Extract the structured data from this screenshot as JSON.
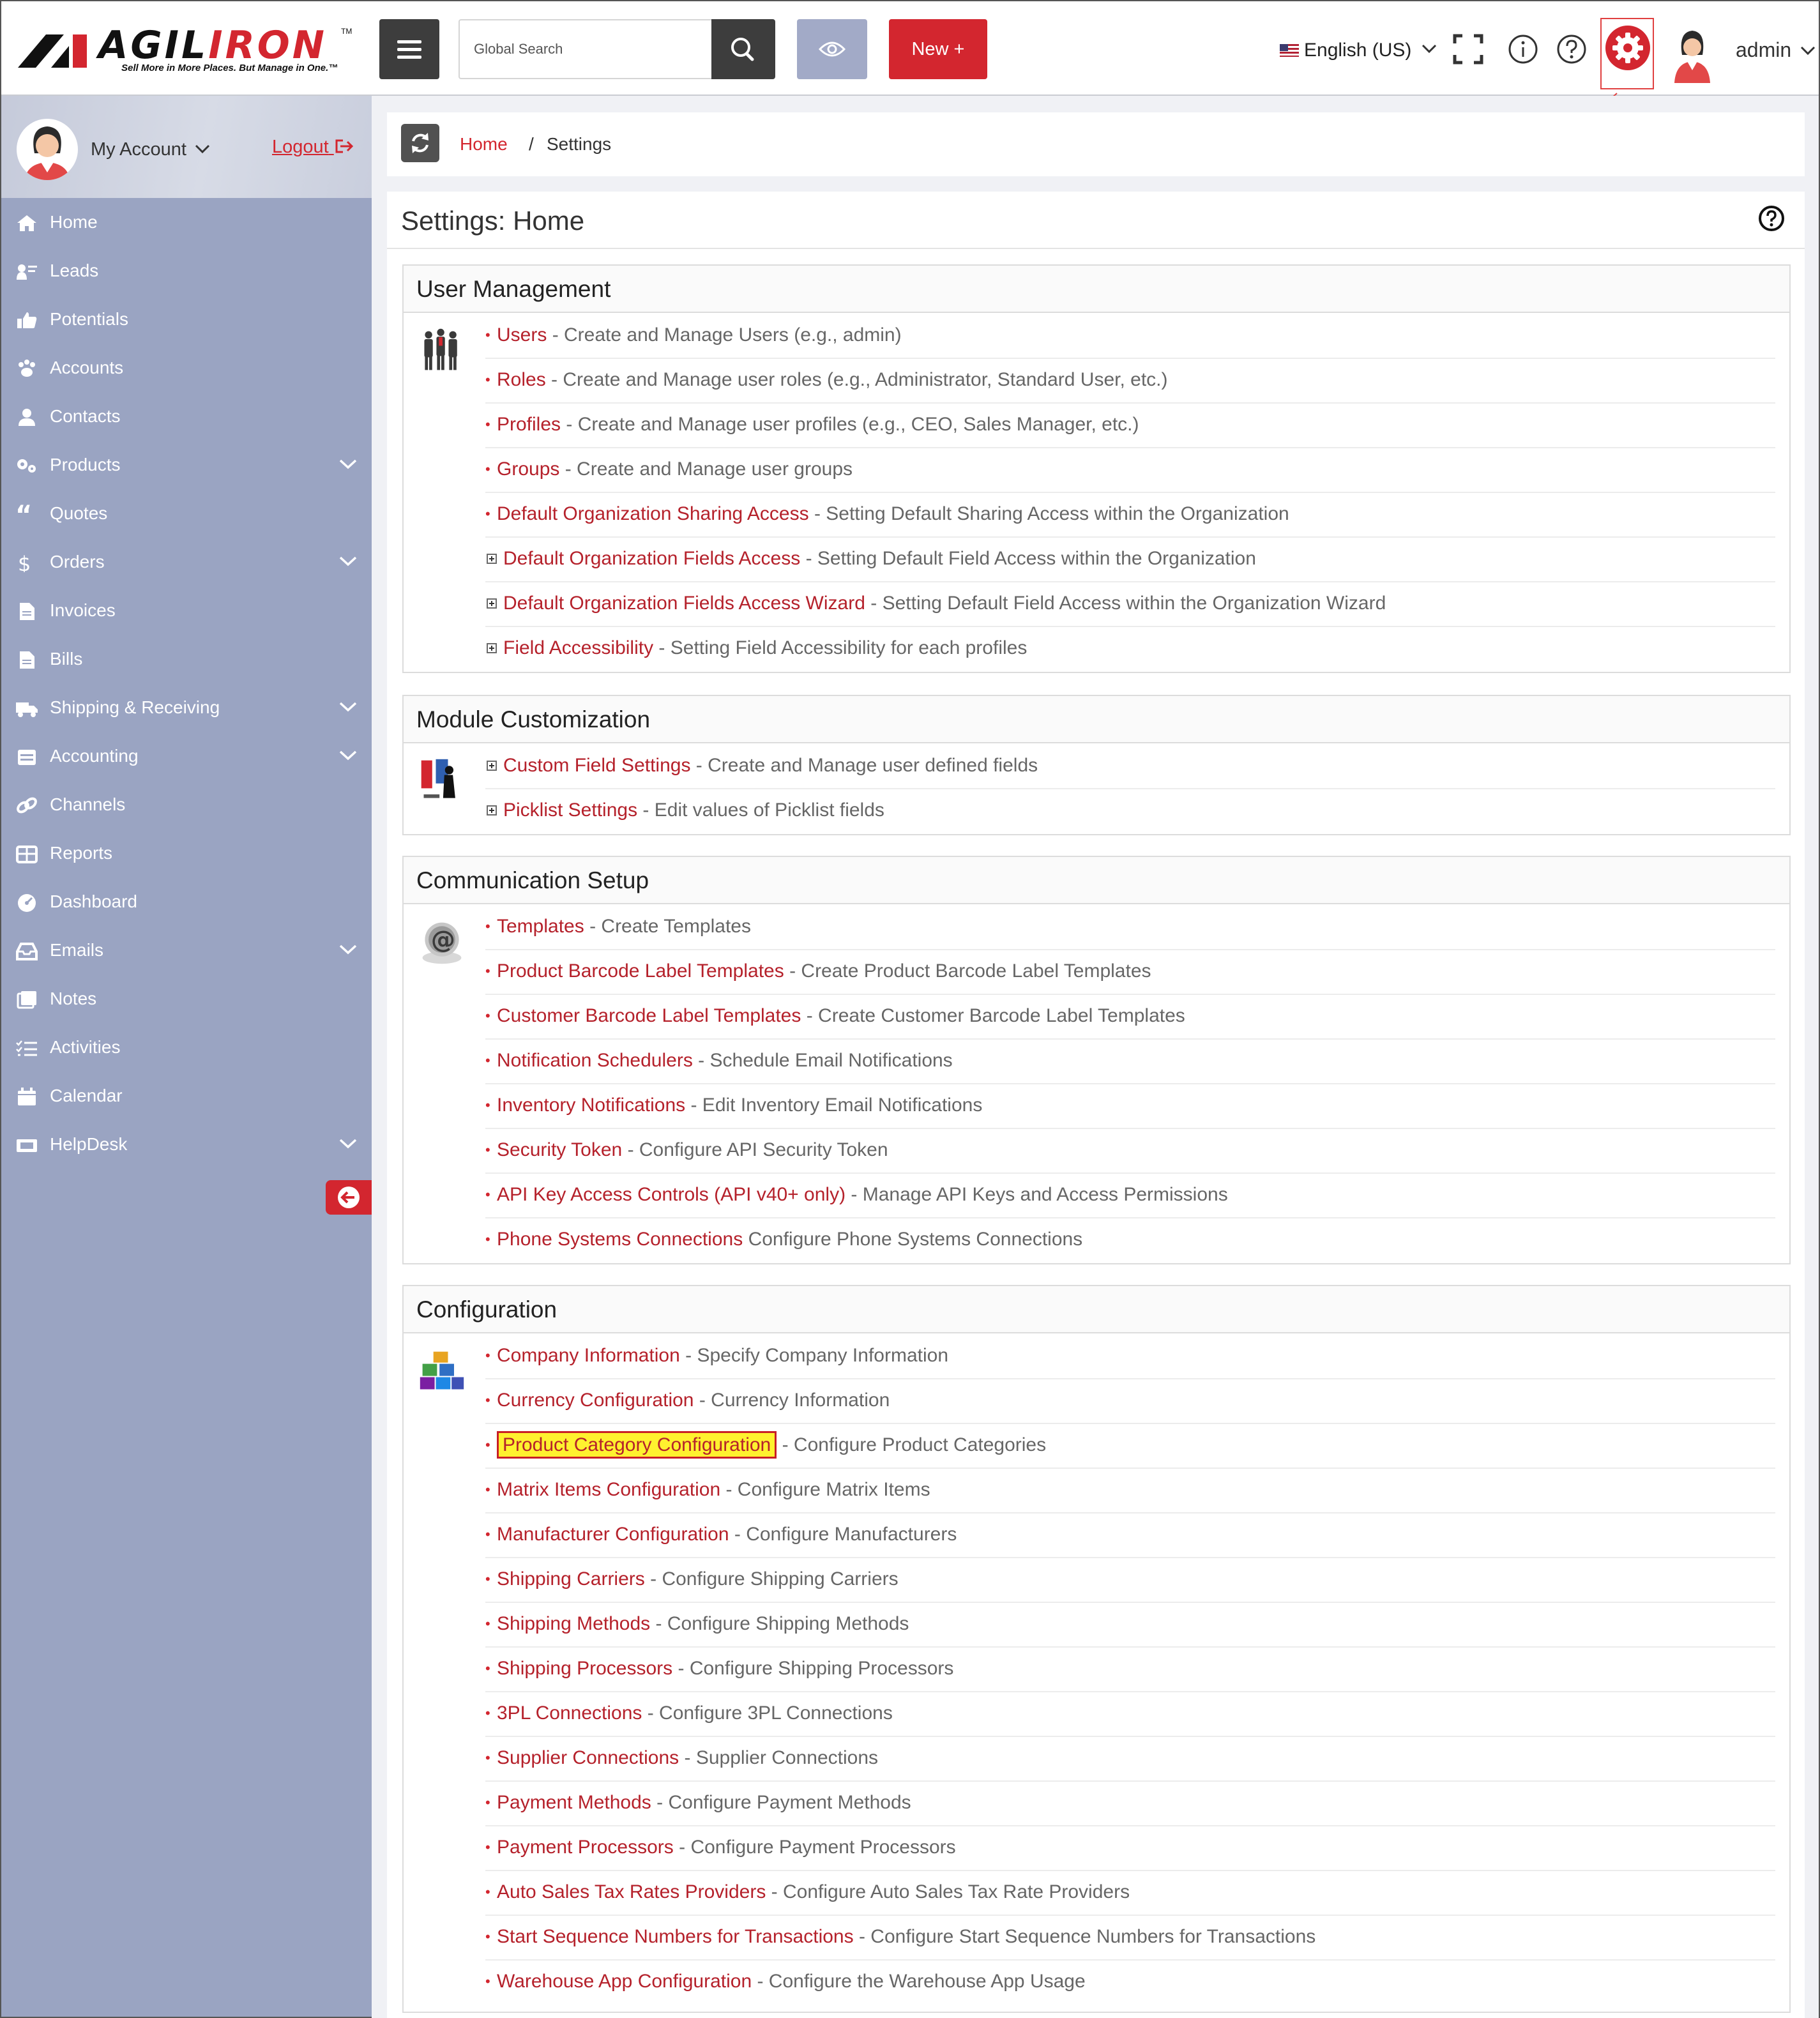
{
  "brand": {
    "name_dark": "AGIL",
    "name_red": "IRON",
    "tm": "TM",
    "tagline": "Sell More in More Places. But Manage in One.™"
  },
  "topbar": {
    "search_placeholder": "Global Search",
    "new_label": "New +",
    "language": "English (US)",
    "user": "admin",
    "icons": [
      "menu-icon",
      "search-icon",
      "eye-icon",
      "fullscreen-icon",
      "info-icon",
      "help-icon",
      "gear-icon",
      "avatar"
    ],
    "accent": "#d3262f"
  },
  "sidebar": {
    "account_label": "My Account",
    "logout_label": "Logout",
    "bg": "#9aa4c2",
    "items": [
      {
        "label": "Home",
        "icon": "home-icon",
        "expandable": false
      },
      {
        "label": "Leads",
        "icon": "leads-icon",
        "expandable": false
      },
      {
        "label": "Potentials",
        "icon": "thumbs-up-icon",
        "expandable": false
      },
      {
        "label": "Accounts",
        "icon": "paw-icon",
        "expandable": false
      },
      {
        "label": "Contacts",
        "icon": "user-icon",
        "expandable": false
      },
      {
        "label": "Products",
        "icon": "gears-icon",
        "expandable": true
      },
      {
        "label": "Quotes",
        "icon": "quote-icon",
        "expandable": false
      },
      {
        "label": "Orders",
        "icon": "dollar-icon",
        "expandable": true
      },
      {
        "label": "Invoices",
        "icon": "file-icon",
        "expandable": false
      },
      {
        "label": "Bills",
        "icon": "file-icon",
        "expandable": false
      },
      {
        "label": "Shipping & Receiving",
        "icon": "truck-icon",
        "expandable": true
      },
      {
        "label": "Accounting",
        "icon": "calculator-icon",
        "expandable": true
      },
      {
        "label": "Channels",
        "icon": "link-icon",
        "expandable": false
      },
      {
        "label": "Reports",
        "icon": "table-icon",
        "expandable": false
      },
      {
        "label": "Dashboard",
        "icon": "dashboard-icon",
        "expandable": false
      },
      {
        "label": "Emails",
        "icon": "inbox-icon",
        "expandable": true
      },
      {
        "label": "Notes",
        "icon": "notes-icon",
        "expandable": false
      },
      {
        "label": "Activities",
        "icon": "list-icon",
        "expandable": false
      },
      {
        "label": "Calendar",
        "icon": "calendar-icon",
        "expandable": false
      },
      {
        "label": "HelpDesk",
        "icon": "ticket-icon",
        "expandable": true
      }
    ]
  },
  "breadcrumb": {
    "home": "Home",
    "separator": "/",
    "current": "Settings"
  },
  "page": {
    "title": "Settings: Home"
  },
  "sections": [
    {
      "title": "User Management",
      "image": "users-group-icon",
      "items": [
        {
          "marker": "bullet",
          "link": "Users",
          "desc": "- Create and Manage Users (e.g., admin)"
        },
        {
          "marker": "bullet",
          "link": "Roles",
          "desc": "- Create and Manage user roles (e.g., Administrator, Standard User, etc.)"
        },
        {
          "marker": "bullet",
          "link": "Profiles",
          "desc": "- Create and Manage user profiles (e.g., CEO, Sales Manager, etc.)"
        },
        {
          "marker": "bullet",
          "link": "Groups",
          "desc": "- Create and Manage user groups"
        },
        {
          "marker": "bullet",
          "link": "Default Organization Sharing Access",
          "desc": "- Setting Default Sharing Access within the Organization"
        },
        {
          "marker": "plus",
          "link": "Default Organization Fields Access",
          "desc": "- Setting Default Field Access within the Organization"
        },
        {
          "marker": "plus",
          "link": "Default Organization Fields Access Wizard",
          "desc": "- Setting Default Field Access within the Organization Wizard"
        },
        {
          "marker": "plus",
          "link": "Field Accessibility",
          "desc": "- Setting Field Accessibility for each profiles"
        }
      ]
    },
    {
      "title": "Module Customization",
      "image": "custom-fields-icon",
      "items": [
        {
          "marker": "plus",
          "link": "Custom Field Settings",
          "desc": "- Create and Manage user defined fields"
        },
        {
          "marker": "plus",
          "link": "Picklist Settings",
          "desc": "- Edit values of Picklist fields"
        }
      ]
    },
    {
      "title": "Communication Setup",
      "image": "email-at-icon",
      "items": [
        {
          "marker": "bullet",
          "link": "Templates",
          "desc": "- Create Templates"
        },
        {
          "marker": "bullet",
          "link": "Product Barcode Label Templates",
          "desc": "- Create Product Barcode Label Templates"
        },
        {
          "marker": "bullet",
          "link": "Customer Barcode Label Templates",
          "desc": "- Create Customer Barcode Label Templates"
        },
        {
          "marker": "bullet",
          "link": "Notification Schedulers",
          "desc": "- Schedule Email Notifications"
        },
        {
          "marker": "bullet",
          "link": "Inventory Notifications",
          "desc": "- Edit Inventory Email Notifications"
        },
        {
          "marker": "bullet",
          "link": "Security Token",
          "desc": "- Configure API Security Token"
        },
        {
          "marker": "bullet",
          "link": "API Key Access Controls (API v40+ only)",
          "desc": "- Manage API Keys and Access Permissions"
        },
        {
          "marker": "bullet",
          "link": "Phone Systems Connections",
          "desc": "Configure Phone Systems Connections"
        }
      ]
    },
    {
      "title": "Configuration",
      "image": "config-blocks-icon",
      "items": [
        {
          "marker": "bullet",
          "link": "Company Information",
          "desc": "- Specify Company Information"
        },
        {
          "marker": "bullet",
          "link": "Currency Configuration",
          "desc": "- Currency Information"
        },
        {
          "marker": "bullet",
          "link": "Product Category Configuration",
          "desc": "- Configure Product Categories",
          "highlight": true
        },
        {
          "marker": "bullet",
          "link": "Matrix Items Configuration",
          "desc": "- Configure Matrix Items"
        },
        {
          "marker": "bullet",
          "link": "Manufacturer Configuration",
          "desc": "- Configure Manufacturers"
        },
        {
          "marker": "bullet",
          "link": "Shipping Carriers",
          "desc": "- Configure Shipping Carriers"
        },
        {
          "marker": "bullet",
          "link": "Shipping Methods",
          "desc": "- Configure Shipping Methods"
        },
        {
          "marker": "bullet",
          "link": "Shipping Processors",
          "desc": "- Configure Shipping Processors"
        },
        {
          "marker": "bullet",
          "link": "3PL Connections",
          "desc": "- Configure 3PL Connections"
        },
        {
          "marker": "bullet",
          "link": "Supplier Connections",
          "desc": "- Supplier Connections"
        },
        {
          "marker": "bullet",
          "link": "Payment Methods",
          "desc": "- Configure Payment Methods"
        },
        {
          "marker": "bullet",
          "link": "Payment Processors",
          "desc": "- Configure Payment Processors"
        },
        {
          "marker": "bullet",
          "link": "Auto Sales Tax Rates Providers",
          "desc": "- Configure Auto Sales Tax Rate Providers"
        },
        {
          "marker": "bullet",
          "link": "Start Sequence Numbers for Transactions",
          "desc": "- Configure Start Sequence Numbers for Transactions"
        },
        {
          "marker": "bullet",
          "link": "Warehouse App Configuration",
          "desc": "- Configure the Warehouse App Usage"
        }
      ]
    }
  ]
}
